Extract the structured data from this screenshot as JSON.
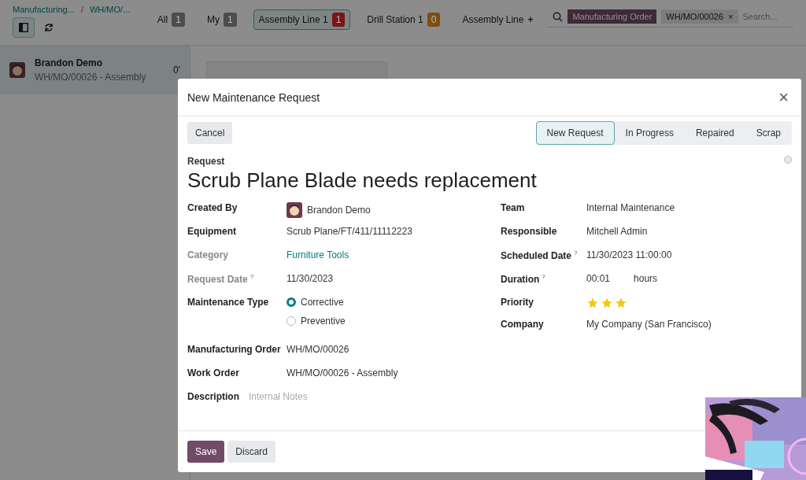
{
  "breadcrumb": [
    "Manufacturing...",
    "WH/MO/..."
  ],
  "breadcrumb_separator": "/",
  "filters": [
    {
      "label": "All",
      "count": "1",
      "color": "#4d4d4d",
      "selected": false
    },
    {
      "label": "My",
      "count": "1",
      "color": "#4d4d4d",
      "selected": false
    },
    {
      "label": "Assembly Line 1",
      "count": "1",
      "color": "#7a1518",
      "selected": true
    },
    {
      "label": "Drill Station 1",
      "count": "0",
      "color": "#7f4e11",
      "selected": false
    }
  ],
  "add_filter": {
    "label": "Assembly Line",
    "icon": "+"
  },
  "search": {
    "facet_label": "Manufacturing Order",
    "facet_value": "WH/MO/00026",
    "facet_remove": "×",
    "placeholder": "Search..."
  },
  "side_item": {
    "name": "Brandon Demo",
    "subtitle": "WH/MO/00026 - Assembly",
    "time": "0'",
    "selected": true
  },
  "dialog": {
    "title": "New Maintenance Request",
    "close": "×",
    "cancel": "Cancel",
    "stages": [
      {
        "label": "New Request",
        "selected": true
      },
      {
        "label": "In Progress",
        "selected": false
      },
      {
        "label": "Repaired",
        "selected": false
      },
      {
        "label": "Scrap",
        "selected": false
      }
    ],
    "request_label": "Request",
    "request_name": "Scrub Plane Blade needs replacement",
    "left_fields": [
      {
        "label": "Created By",
        "kind": "avatar",
        "value": "Brandon Demo",
        "muted": false
      },
      {
        "label": "Equipment",
        "kind": "text",
        "value": "Scrub Plane/FT/411/11112223",
        "muted": false
      },
      {
        "label": "Category",
        "kind": "link",
        "value": "Furniture Tools",
        "muted": true
      },
      {
        "label": "Request Date",
        "help": "?",
        "kind": "text",
        "value": "11/30/2023",
        "muted": true
      },
      {
        "label": "Maintenance Type",
        "kind": "radio",
        "options": [
          {
            "label": "Corrective",
            "selected": true
          },
          {
            "label": "Preventive",
            "selected": false
          }
        ],
        "muted": false
      },
      {
        "label": "Manufacturing Order",
        "kind": "text",
        "value": "WH/MO/00026",
        "muted": false
      },
      {
        "label": "Work Order",
        "kind": "text",
        "value": "WH/MO/00026 - Assembly",
        "muted": false
      },
      {
        "label": "Description",
        "kind": "notes",
        "placeholder": "Internal Notes",
        "muted": false
      }
    ],
    "right_fields": [
      {
        "label": "Team",
        "kind": "text",
        "value": "Internal Maintenance"
      },
      {
        "label": "Responsible",
        "kind": "text",
        "value": "Mitchell Admin"
      },
      {
        "label": "Scheduled Date",
        "help": "?",
        "kind": "text",
        "value": "11/30/2023 11:00:00"
      },
      {
        "label": "Duration",
        "help": "?",
        "kind": "duration",
        "value": "00:01",
        "unit": "hours"
      },
      {
        "label": "Priority",
        "kind": "stars",
        "stars": 3
      },
      {
        "label": "Company",
        "kind": "text",
        "value": "My Company (San Francisco)"
      }
    ],
    "buttons": [
      {
        "label": "Save",
        "kind": "primary"
      },
      {
        "label": "Discard",
        "kind": "secondary"
      }
    ]
  }
}
